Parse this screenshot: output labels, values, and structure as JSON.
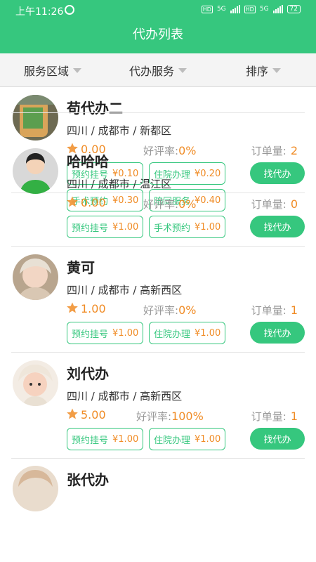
{
  "status": {
    "time": "上午11:26",
    "battery": "72",
    "net1": "5G",
    "net2": "5G"
  },
  "header": {
    "title": "代办列表"
  },
  "filters": [
    {
      "label": "服务区域"
    },
    {
      "label": "代办服务"
    },
    {
      "label": "排序"
    }
  ],
  "labels": {
    "rate": "好评率:",
    "orders": "订单量:",
    "button": "找代办"
  },
  "agents": [
    {
      "name": "苟代办二",
      "location": "四川 / 成都市 / 新都区",
      "score": "0.00",
      "rate": "0%",
      "orders": "2",
      "services": [
        {
          "name": "预约挂号",
          "price": "¥0.10"
        },
        {
          "name": "住院办理",
          "price": "¥0.20"
        },
        {
          "name": "手术预约",
          "price": "¥0.30"
        },
        {
          "name": "陪同服务",
          "price": "¥0.40"
        }
      ]
    },
    {
      "name": "哈哈哈",
      "location": "四川 / 成都市 / 温江区",
      "score": "0.00",
      "rate": "0%",
      "orders": "0",
      "services": [
        {
          "name": "预约挂号",
          "price": "¥1.00"
        },
        {
          "name": "手术预约",
          "price": "¥1.00"
        }
      ]
    },
    {
      "name": "黄可",
      "location": "四川 / 成都市 / 高新西区",
      "score": "1.00",
      "rate": "0%",
      "orders": "1",
      "services": [
        {
          "name": "预约挂号",
          "price": "¥1.00"
        },
        {
          "name": "住院办理",
          "price": "¥1.00"
        }
      ]
    },
    {
      "name": "刘代办",
      "location": "四川 / 成都市 / 高新西区",
      "score": "5.00",
      "rate": "100%",
      "orders": "1",
      "services": [
        {
          "name": "预约挂号",
          "price": "¥1.00"
        },
        {
          "name": "住院办理",
          "price": "¥1.00"
        }
      ]
    },
    {
      "name": "张代办"
    }
  ],
  "colors": {
    "primary": "#36c77e",
    "accent": "#f08c26"
  }
}
